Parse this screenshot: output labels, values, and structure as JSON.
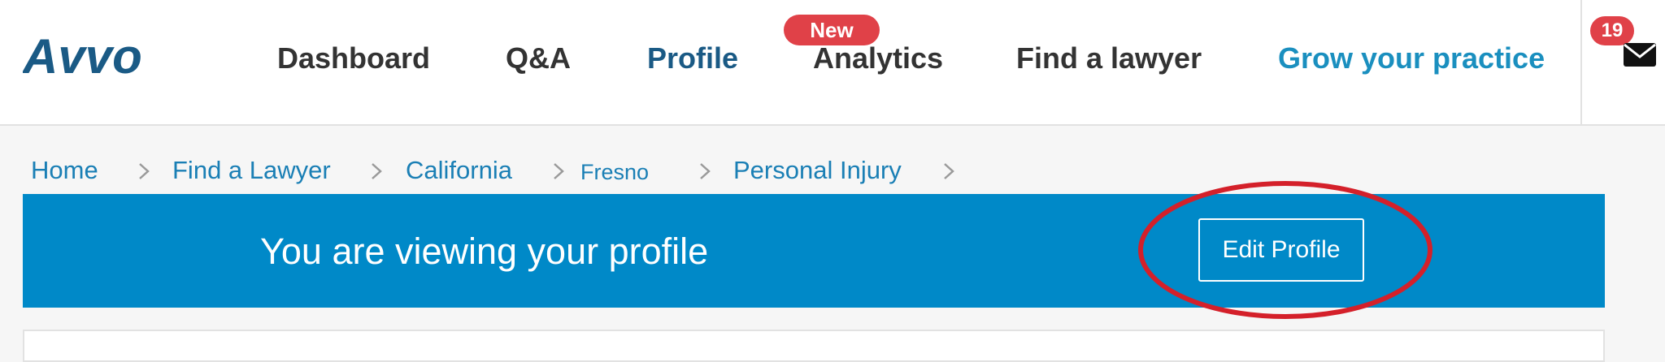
{
  "header": {
    "logo_text": "Avvo",
    "nav": [
      {
        "label": "Dashboard"
      },
      {
        "label": "Q&A"
      },
      {
        "label": "Profile"
      },
      {
        "label": "Analytics",
        "badge": "New"
      },
      {
        "label": "Find a lawyer"
      },
      {
        "label": "Grow your practice"
      }
    ],
    "messages": {
      "count": "19",
      "icon": "envelope-icon"
    }
  },
  "breadcrumb": [
    {
      "label": "Home"
    },
    {
      "label": "Find a Lawyer"
    },
    {
      "label": "California"
    },
    {
      "label": "Fresno"
    },
    {
      "label": "Personal Injury"
    }
  ],
  "banner": {
    "text": "You are viewing your profile",
    "edit_label": "Edit Profile"
  },
  "colors": {
    "brand": "#1a5a85",
    "banner": "#0089c8",
    "badge": "#e04148",
    "link": "#1a7fb5",
    "annotation": "#d4202a"
  }
}
